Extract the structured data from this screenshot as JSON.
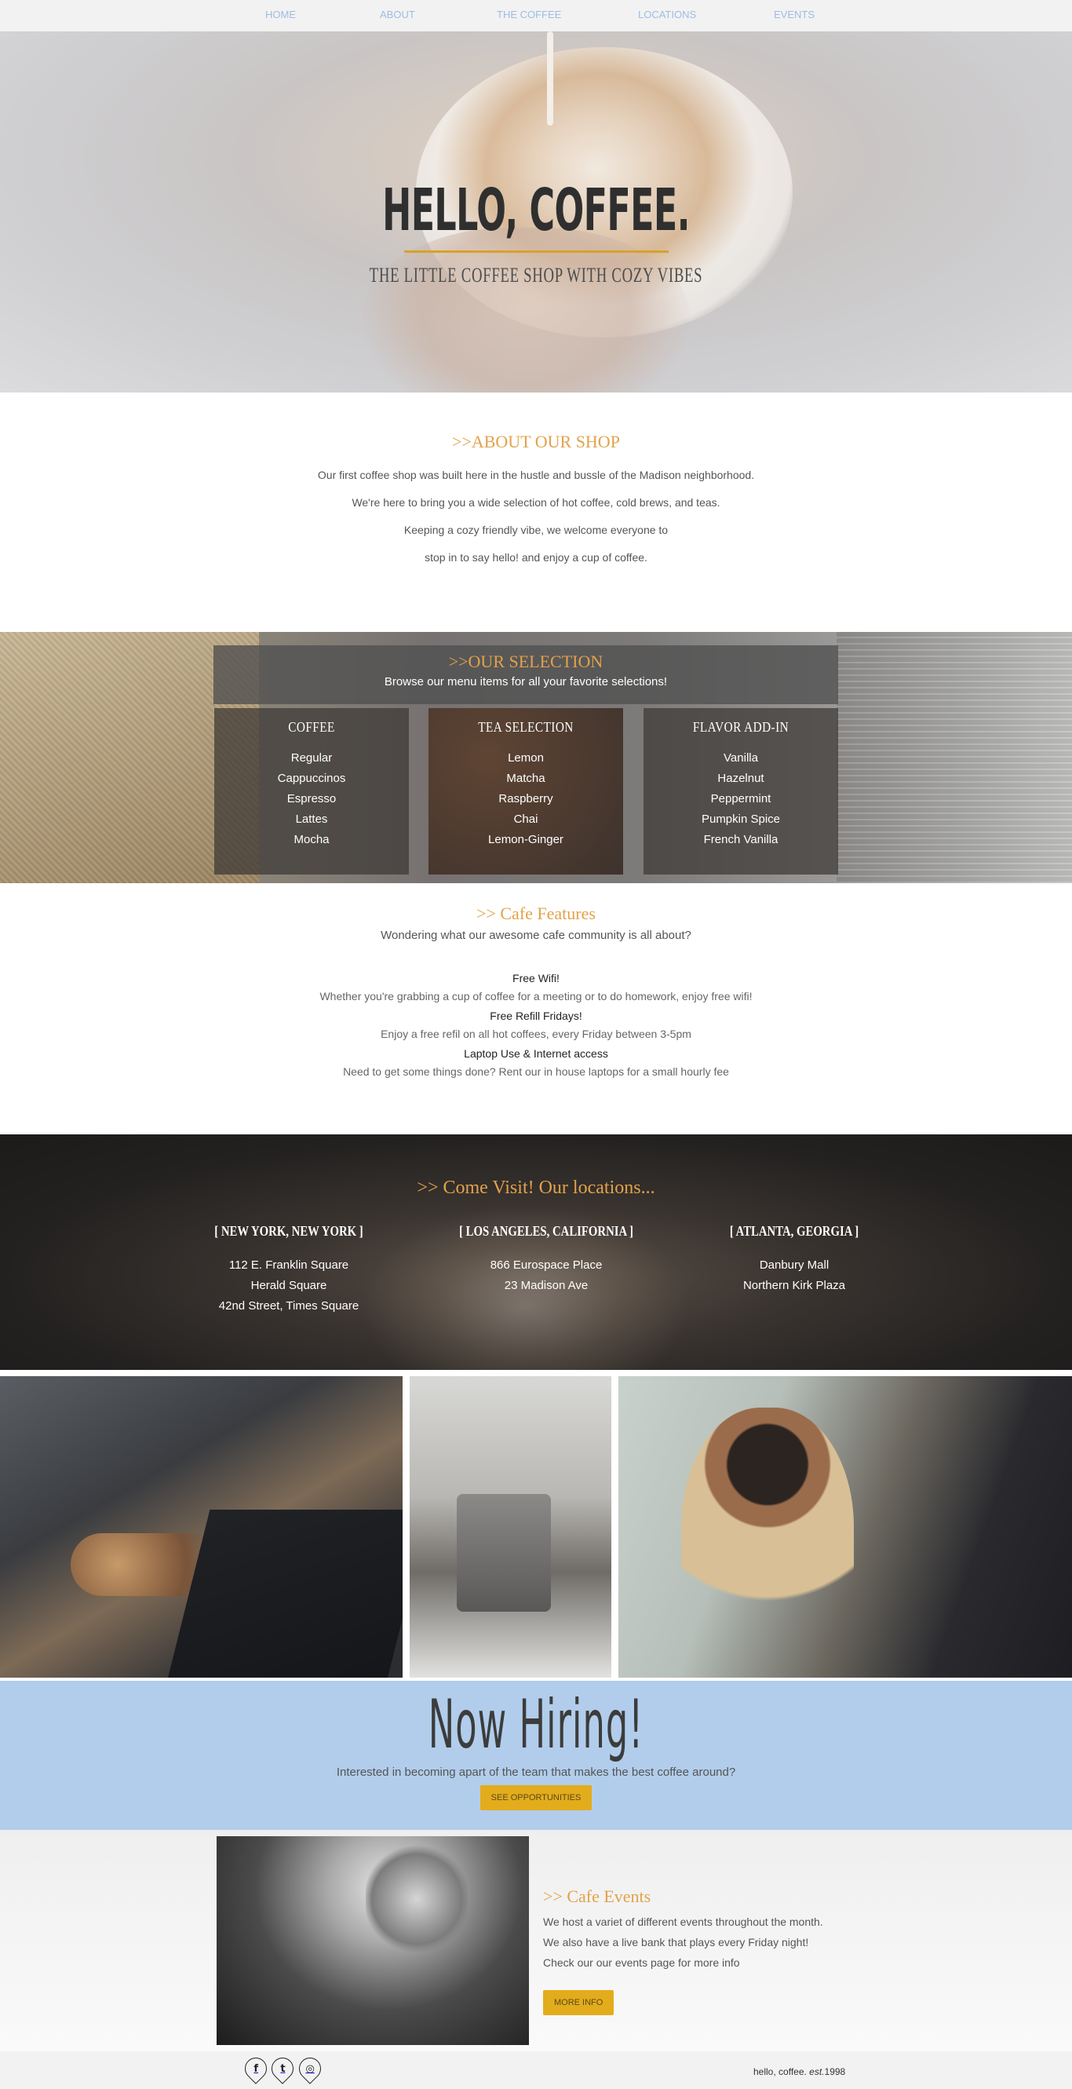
{
  "nav": {
    "items": [
      "HOME",
      "ABOUT",
      "THE COFFEE",
      "LOCATIONS",
      "EVENTS"
    ]
  },
  "hero": {
    "title": "HELLO, COFFEE.",
    "subtitle": "THE LITTLE COFFEE SHOP WITH COZY VIBES"
  },
  "about": {
    "title": ">>ABOUT OUR SHOP",
    "lines": [
      "Our first coffee shop was built here in the hustle and bussle of the Madison neighborhood.",
      "We're here to bring you a wide selection of hot coffee, cold brews, and teas.",
      "Keeping a cozy friendly vibe, we welcome everyone to",
      "stop in to say hello! and enjoy a cup of coffee."
    ]
  },
  "selection": {
    "title": ">>OUR SELECTION",
    "subtitle": "Browse our menu items for all your favorite selections!",
    "columns": [
      {
        "title": "COFFEE",
        "items": [
          "Regular",
          "Cappuccinos",
          "Espresso",
          "Lattes",
          "Mocha"
        ]
      },
      {
        "title": "TEA SELECTION",
        "items": [
          "Lemon",
          "Matcha",
          "Raspberry",
          "Chai",
          "Lemon-Ginger"
        ]
      },
      {
        "title": "FLAVOR ADD-IN",
        "items": [
          "Vanilla",
          "Hazelnut",
          "Peppermint",
          "Pumpkin Spice",
          "French Vanilla"
        ]
      }
    ]
  },
  "features": {
    "title": ">> Cafe Features",
    "intro": "Wondering what our awesome cafe community is all about?",
    "items": [
      {
        "name": "Free Wifi!",
        "desc": "Whether you're grabbing a cup of coffee for a meeting or to do homework, enjoy free wifi!"
      },
      {
        "name": "Free Refill Fridays!",
        "desc": "Enjoy a free refil on all hot coffees, every Friday between 3-5pm"
      },
      {
        "name": "Laptop Use & Internet access",
        "desc": "Need to get some things done? Rent our in house laptops for a small hourly fee"
      }
    ]
  },
  "locations": {
    "title": ">> Come Visit! Our locations...",
    "cities": [
      {
        "name": "[ NEW YORK, NEW YORK ]",
        "lines": [
          "112 E. Franklin Square",
          "Herald Square",
          "42nd Street, Times Square"
        ]
      },
      {
        "name": "[ LOS ANGELES, CALIFORNIA ]",
        "lines": [
          "866 Eurospace Place",
          "23 Madison Ave"
        ]
      },
      {
        "name": "[ ATLANTA, GEORGIA ]",
        "lines": [
          "Danbury Mall",
          "Northern Kirk Plaza"
        ]
      }
    ]
  },
  "hiring": {
    "title": "Now Hiring!",
    "text": "Interested in becoming apart of the team that makes the best coffee around?",
    "button": "SEE OPPORTUNITIES"
  },
  "events": {
    "title": ">> Cafe Events",
    "lines": [
      "We host a variet of different events throughout the month.",
      "We also have a live bank that plays every Friday night!",
      "Check our our events page for more info"
    ],
    "button": "MORE INFO"
  },
  "footer": {
    "social_icons": [
      "f",
      "t",
      "◎"
    ],
    "copyright_prefix": "hello, coffee. ",
    "copyright_est": "est.",
    "copyright_year": "1998"
  }
}
